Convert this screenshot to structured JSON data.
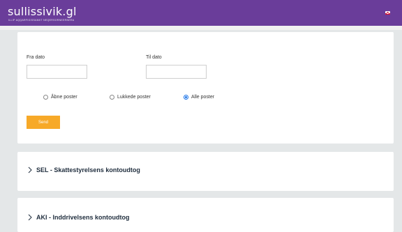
{
  "header": {
    "logo_text": "sullissivik.gl",
    "tagline": "ILLIP AQQARFIGISSAMIIT NEQERSORNEERNERA"
  },
  "filter": {
    "from_label": "Fra dato",
    "to_label": "Til dato",
    "from_value": "",
    "to_value": "",
    "radios": [
      {
        "label": "Åbne poster",
        "checked": false
      },
      {
        "label": "Lukkede poster",
        "checked": false
      },
      {
        "label": "Alle poster",
        "checked": true
      }
    ],
    "send_label": "Send"
  },
  "accordions": [
    {
      "title": "SEL - Skattestyrelsens kontoudtog"
    },
    {
      "title": "AKI - Inddrivelsens kontoudtog"
    }
  ],
  "colors": {
    "brand": "#6a3d9a",
    "button": "#f7a928",
    "background": "#e4e7e8"
  }
}
